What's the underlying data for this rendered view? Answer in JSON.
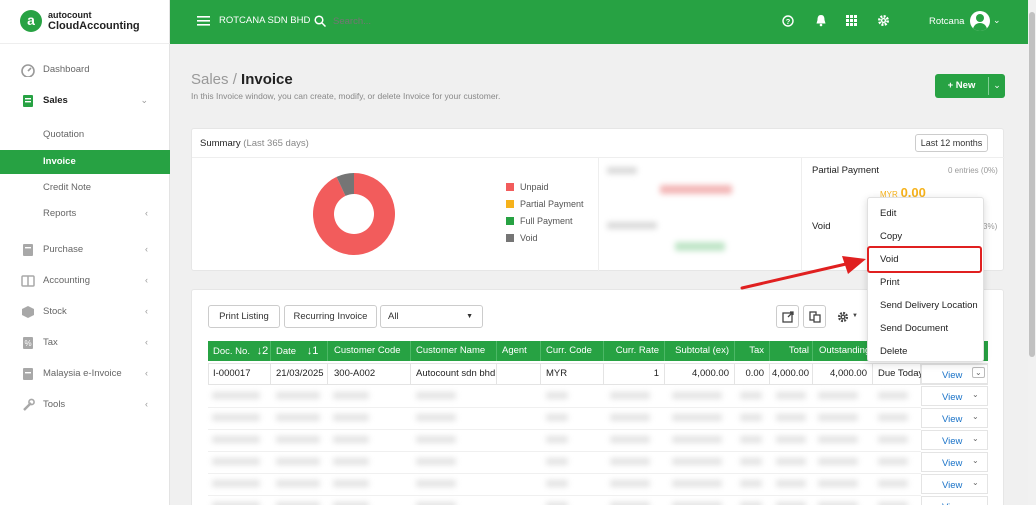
{
  "brand": {
    "logo_letter": "a",
    "line1": "autocount",
    "line2": "CloudAccounting"
  },
  "sidebar": {
    "items": [
      {
        "label": "Dashboard",
        "icon": "dashboard-icon"
      },
      {
        "label": "Sales",
        "icon": "sales-icon"
      },
      {
        "label": "Quotation"
      },
      {
        "label": "Invoice"
      },
      {
        "label": "Credit Note"
      },
      {
        "label": "Reports"
      },
      {
        "label": "Purchase",
        "icon": "purchase-icon"
      },
      {
        "label": "Accounting",
        "icon": "accounting-icon"
      },
      {
        "label": "Stock",
        "icon": "stock-icon"
      },
      {
        "label": "Tax",
        "icon": "tax-icon"
      },
      {
        "label": "Malaysia e-Invoice",
        "icon": "einvoice-icon"
      },
      {
        "label": "Tools",
        "icon": "tools-icon"
      }
    ]
  },
  "topbar": {
    "company": "ROTCANA SDN BHD",
    "search_placeholder": "Search...",
    "user": "Rotcana"
  },
  "page": {
    "parent": "Sales",
    "sep": "/",
    "title": "Invoice",
    "description": "In this Invoice window, you can create, modify, or delete Invoice for your customer.",
    "new_label": "+ New"
  },
  "summary": {
    "title": "Summary",
    "period": "(Last 365 days)",
    "range_button": "Last 12 months",
    "legend": [
      {
        "label": "Unpaid",
        "color": "#f25c5c"
      },
      {
        "label": "Partial Payment",
        "color": "#f6b21b"
      },
      {
        "label": "Full Payment",
        "color": "#27a243"
      },
      {
        "label": "Void",
        "color": "#757575"
      }
    ],
    "donut": [
      {
        "label": "Unpaid",
        "fraction": 0.93
      },
      {
        "label": "Void",
        "fraction": 0.07
      }
    ],
    "partial": {
      "title": "Partial Payment",
      "entries": "0 entries (0%)",
      "currency": "MYR",
      "amount": "0.00"
    },
    "void": {
      "title": "Void",
      "entries_partial": "3%)"
    }
  },
  "toolbar": {
    "print_listing": "Print Listing",
    "recurring_invoice": "Recurring Invoice",
    "filter_value": "All"
  },
  "table": {
    "columns": [
      "Doc. No.",
      "Date",
      "Customer Code",
      "Customer Name",
      "Agent",
      "Curr. Code",
      "Curr. Rate",
      "Subtotal (ex)",
      "Tax",
      "Total",
      "Outstanding"
    ],
    "sort_icons": {
      "doc_no": "↓2",
      "date": "↓1"
    },
    "row": {
      "doc_no": "I-000017",
      "date": "21/03/2025",
      "customer_code": "300-A002",
      "customer_name": "Autocount sdn bhd",
      "agent": "",
      "curr_code": "MYR",
      "curr_rate": "1",
      "subtotal": "4,000.00",
      "tax": "0.00",
      "total": "4,000.00",
      "outstanding": "4,000.00",
      "status": "Due Today"
    },
    "view_label": "View"
  },
  "context_menu": {
    "items": [
      "Edit",
      "Copy",
      "Void",
      "Print",
      "Send Delivery Location",
      "Send Document",
      "Delete"
    ],
    "highlighted": "Void"
  },
  "colors": {
    "brand_green": "#27a243",
    "unpaid_red": "#f25c5c",
    "highlight_red": "#e02020"
  }
}
